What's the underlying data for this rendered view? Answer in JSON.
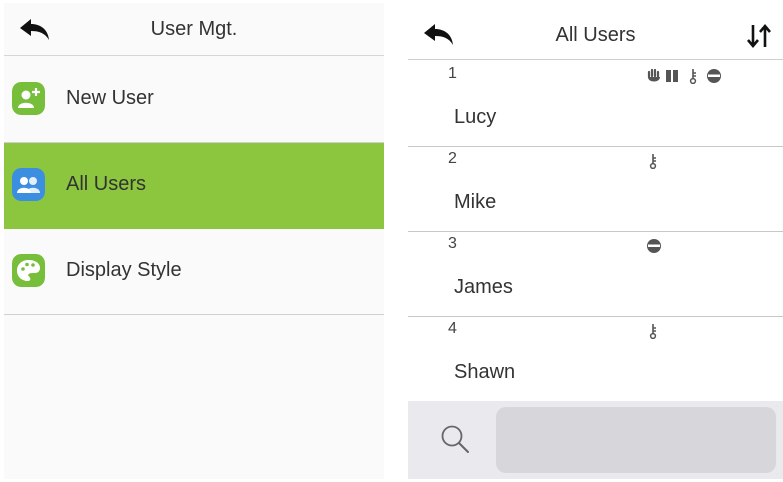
{
  "colors": {
    "accent_green": "#8cc63f",
    "new_user_icon": "#77be3b",
    "all_users_icon": "#3c8fe0",
    "display_style_icon": "#77be3b"
  },
  "left": {
    "title": "User Mgt.",
    "back_icon": "back-arrow-icon",
    "menu": [
      {
        "label": "New User",
        "icon": "add-user-icon",
        "selected": false
      },
      {
        "label": "All Users",
        "icon": "users-icon",
        "selected": true
      },
      {
        "label": "Display Style",
        "icon": "palette-icon",
        "selected": false
      }
    ]
  },
  "right": {
    "title": "All Users",
    "back_icon": "back-arrow-icon",
    "sort_icon": "sort-icon",
    "users": [
      {
        "id": "1",
        "name": "Lucy",
        "icons": [
          "palm-icon",
          "card-icon",
          "key-icon",
          "face-icon"
        ]
      },
      {
        "id": "2",
        "name": "Mike",
        "icons": [
          "key-icon"
        ]
      },
      {
        "id": "3",
        "name": "James",
        "icons": [
          "face-icon"
        ]
      },
      {
        "id": "4",
        "name": "Shawn",
        "icons": [
          "key-icon"
        ]
      }
    ],
    "search": {
      "placeholder": "",
      "value": ""
    }
  }
}
